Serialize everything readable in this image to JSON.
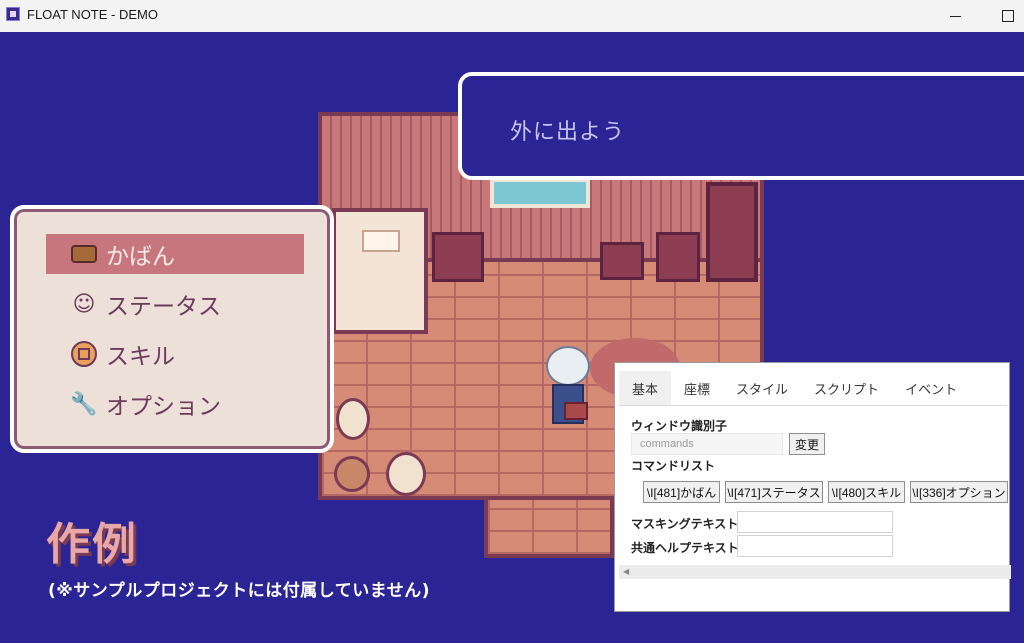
{
  "window": {
    "title": "FLOAT NOTE - DEMO"
  },
  "dialog": {
    "text": "外に出よう"
  },
  "menu": {
    "items": [
      {
        "label": "かばん",
        "icon": "bag-icon",
        "selected": true
      },
      {
        "label": "ステータス",
        "icon": "character-icon",
        "selected": false
      },
      {
        "label": "スキル",
        "icon": "skill-icon",
        "selected": false
      },
      {
        "label": "オプション",
        "icon": "wrench-icon",
        "selected": false
      }
    ]
  },
  "caption": {
    "title": "作例",
    "note": "(※サンプルプロジェクトには付属していません)"
  },
  "editor": {
    "tabs": [
      "基本",
      "座標",
      "スタイル",
      "スクリプト",
      "イベント"
    ],
    "active_tab": "基本",
    "window_id_label": "ウィンドウ識別子",
    "window_id_value": "commands",
    "change_button": "変更",
    "command_list_label": "コマンドリスト",
    "commands": [
      "\\I[481]かばん",
      "\\I[471]ステータス",
      "\\I[480]スキル",
      "\\I[336]オプション"
    ],
    "masking_label": "マスキングテキスト",
    "masking_value": "",
    "help_label": "共通ヘルプテキスト",
    "help_value": ""
  },
  "colors": {
    "background": "#2b2494",
    "menu_selected": "#c8767d",
    "menu_text": "#6b3a5c",
    "caption_title": "#e8a8a8"
  }
}
